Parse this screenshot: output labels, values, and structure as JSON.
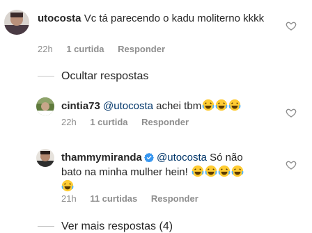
{
  "comments": [
    {
      "username": "utocosta",
      "text": "Vc tá parecendo o kadu moliterno kkkk",
      "time": "22h",
      "likes": "1 curtida",
      "reply": "Responder"
    }
  ],
  "hide_replies": "Ocultar respostas",
  "replies": [
    {
      "username": "cintia73",
      "mention": "@utocosta",
      "text": "achei tbm",
      "time": "22h",
      "likes": "1 curtida",
      "reply": "Responder"
    },
    {
      "username": "thammymiranda",
      "mention": "@utocosta",
      "text_line1": "Só não",
      "text_line2": "bato na minha mulher hein!",
      "time": "21h",
      "likes": "11 curtidas",
      "reply": "Responder"
    }
  ],
  "more_replies": "Ver mais respostas (4)",
  "colors": {
    "mention": "#003569",
    "muted": "#8e8e8e",
    "verified": "#3897f0"
  },
  "icons": [
    "heart-icon",
    "verified-badge-icon",
    "laughing-emoji-icon"
  ]
}
